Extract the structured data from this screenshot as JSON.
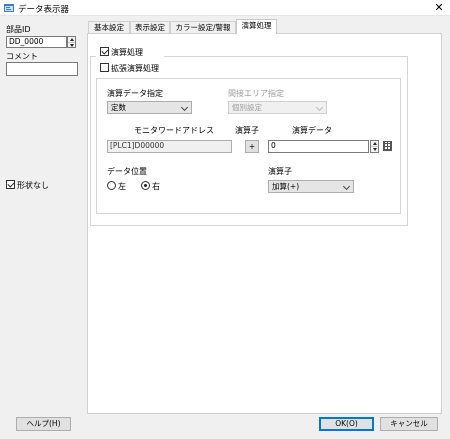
{
  "window": {
    "title": "データ表示器",
    "close_glyph": "✕"
  },
  "left_panel": {
    "part_id_label": "部品ID",
    "part_id_value": "DD_0000",
    "comment_label": "コメント",
    "comment_value": "",
    "no_shape_label": "形状なし",
    "no_shape_checked": true
  },
  "tabs": [
    "基本設定",
    "表示設定",
    "カラー設定/警報",
    "演算処理"
  ],
  "active_tab": 3,
  "main": {
    "calc_process_label": "演算処理",
    "calc_process_checked": true,
    "extended_calc_label": "拡張演算処理",
    "extended_calc_checked": false,
    "calc_data_spec_label": "演算データ指定",
    "calc_data_spec_value": "定数",
    "indirect_area_label": "間接エリア指定",
    "indirect_area_value": "個別設定",
    "monitor_word_label": "モニタワードアドレス",
    "monitor_word_value": "[PLC1]D00000",
    "operator_label_1": "演算子",
    "operator_value_1": "+",
    "calc_data_label": "演算データ",
    "calc_data_value": "0",
    "data_position_label": "データ位置",
    "radio_left_label": "左",
    "radio_right_label": "右",
    "selected_position": "右",
    "operator_label_2": "演算子",
    "operator_combo_value": "加算(+)"
  },
  "footer": {
    "help_label": "ヘルプ(H)",
    "ok_label": "OK(O)",
    "cancel_label": "キャンセル"
  }
}
